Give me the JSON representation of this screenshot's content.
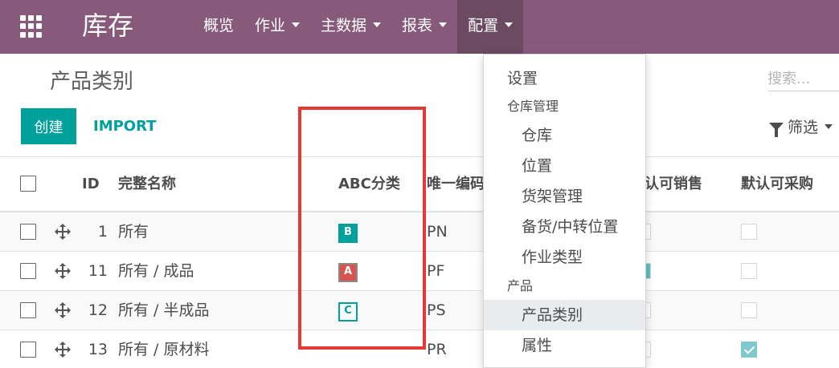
{
  "navbar": {
    "app_title": "库存",
    "menu": [
      {
        "label": "概览",
        "dropdown": false
      },
      {
        "label": "作业",
        "dropdown": true
      },
      {
        "label": "主数据",
        "dropdown": true
      },
      {
        "label": "报表",
        "dropdown": true
      },
      {
        "label": "配置",
        "dropdown": true,
        "active": true
      }
    ]
  },
  "control_panel": {
    "title": "产品类别",
    "create_label": "创建",
    "import_label": "IMPORT",
    "search_placeholder": "搜索...",
    "filter_label": "筛选"
  },
  "table": {
    "columns": {
      "id": "ID",
      "name": "完整名称",
      "abc": "ABC分类",
      "code": "唯一编码",
      "sale": "默认可销售",
      "purchase": "默认可采购"
    },
    "rows": [
      {
        "id": "1",
        "name": "所有",
        "abc": "B",
        "code": "PN",
        "sale": false,
        "purchase": false
      },
      {
        "id": "11",
        "name": "所有 / 成品",
        "abc": "A",
        "code": "PF",
        "sale": true,
        "purchase": false
      },
      {
        "id": "12",
        "name": "所有 / 半成品",
        "abc": "C",
        "code": "PS",
        "sale": false,
        "purchase": false
      },
      {
        "id": "13",
        "name": "所有 / 原材料",
        "abc": "",
        "code": "PR",
        "sale": false,
        "purchase": true
      }
    ]
  },
  "abc_colors": {
    "A": "#d9534f",
    "B": "#00a09d",
    "C": "#00a09d"
  },
  "dropdown": {
    "settings": "设置",
    "warehouse_header": "仓库管理",
    "warehouse_items": [
      "仓库",
      "位置",
      "货架管理",
      "备货/中转位置",
      "作业类型"
    ],
    "product_header": "产品",
    "product_items": [
      "产品类别",
      "属性"
    ],
    "active_item": "产品类别"
  },
  "colors": {
    "navbar": "#875a7b",
    "accent": "#00a09d",
    "highlight": "#e53935"
  }
}
